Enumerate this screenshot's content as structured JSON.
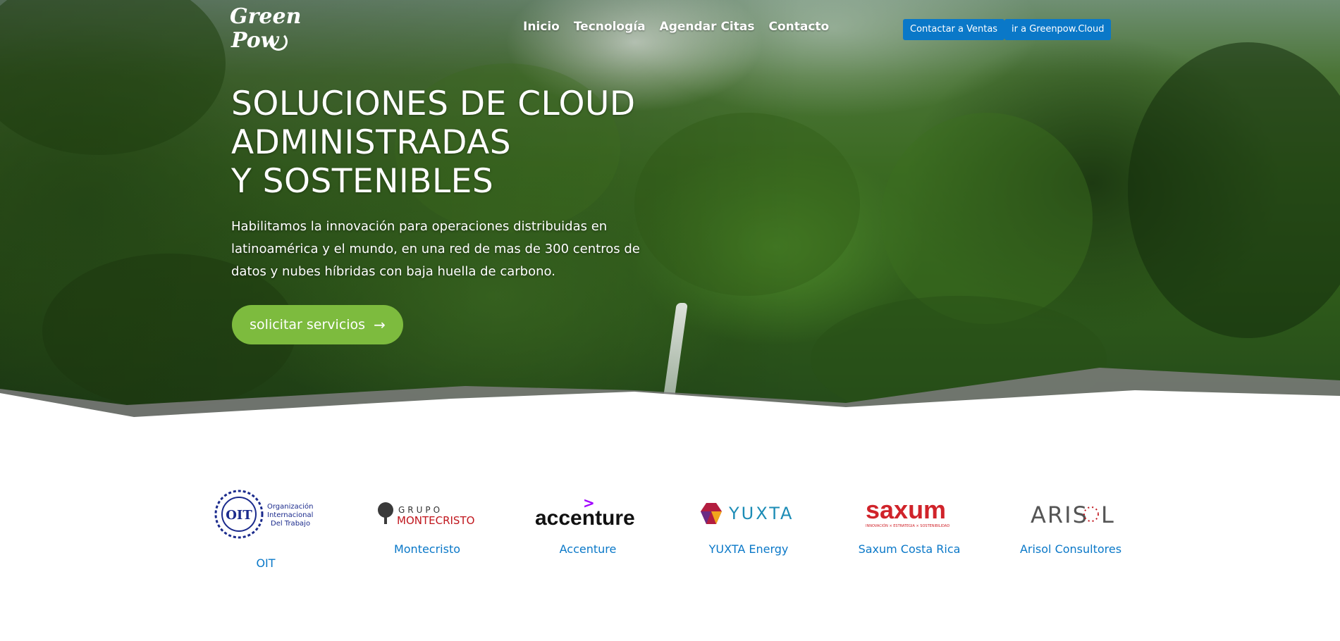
{
  "brand": {
    "logo_line1": "Green",
    "logo_line2": "Pow"
  },
  "nav": {
    "items": [
      "Inicio",
      "Tecnología",
      "Agendar Citas",
      "Contacto"
    ]
  },
  "header_buttons": {
    "sales": "Contactar a Ventas",
    "cloud": "ir a Greenpow.Cloud"
  },
  "hero": {
    "title_lines": [
      "SOLUCIONES DE CLOUD",
      "ADMINISTRADAS",
      "Y SOSTENIBLES"
    ],
    "description": "Habilitamos la innovación para operaciones distribuidas en latinoamérica y el mundo, en una red de mas de 300 centros de datos y nubes híbridas con baja huella de carbono.",
    "cta_label": "solicitar servicios",
    "cta_icon": "arrow-right-icon"
  },
  "clients": [
    {
      "name": "OIT",
      "logo_text": [
        "OIT",
        "Organización",
        "Internacional",
        "Del Trabajo"
      ]
    },
    {
      "name": "Montecristo",
      "logo_text": [
        "GRUPO",
        "MONTECRISTO"
      ]
    },
    {
      "name": "Accenture",
      "logo_text": [
        "accenture"
      ]
    },
    {
      "name": "YUXTA Energy",
      "logo_text": [
        "YUXTA"
      ]
    },
    {
      "name": "Saxum Costa Rica",
      "logo_text": [
        "saxum",
        "INNOVACIÓN × ESTRATEGIA × SOSTENIBILIDAD"
      ]
    },
    {
      "name": "Arisol Consultores",
      "logo_text": [
        "ARIS",
        "L"
      ]
    }
  ],
  "colors": {
    "accent_blue": "#0a78c8",
    "cta_green": "#7dbb3e",
    "saxum_red": "#d0232a",
    "accenture_purple": "#a100ff"
  }
}
